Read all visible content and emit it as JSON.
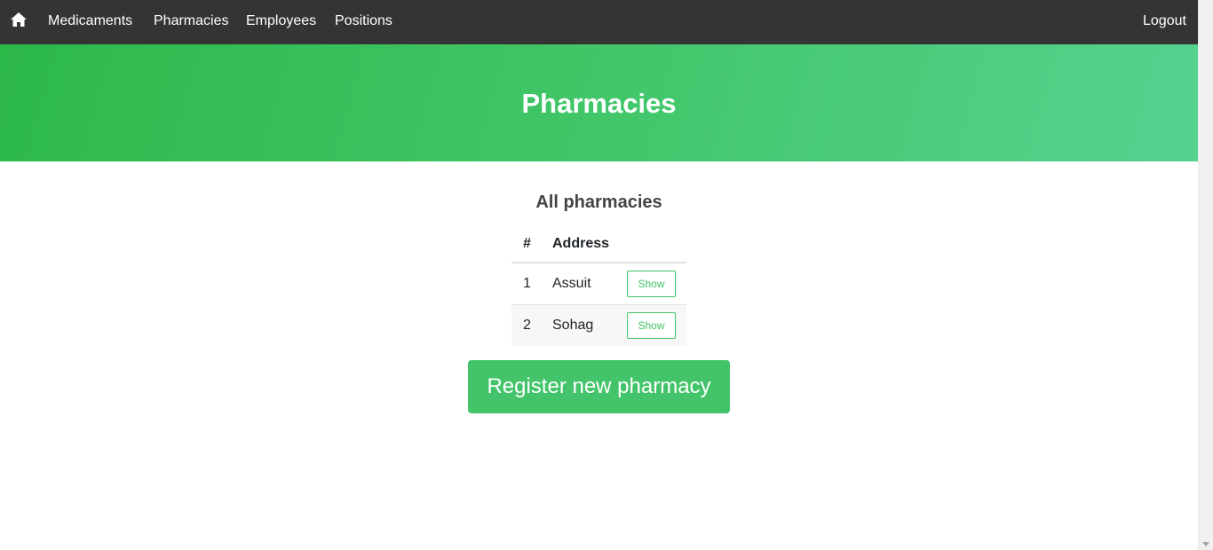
{
  "navbar": {
    "home_icon": "home-icon",
    "items": [
      {
        "label": "Medicaments"
      },
      {
        "label": "Pharmacies"
      },
      {
        "label": "Employees"
      },
      {
        "label": "Positions"
      }
    ],
    "logout_label": "Logout"
  },
  "hero": {
    "title": "Pharmacies"
  },
  "main": {
    "section_title": "All pharmacies",
    "table": {
      "columns": [
        "#",
        "Address"
      ],
      "rows": [
        {
          "num": "1",
          "address": "Assuit",
          "action": "Show"
        },
        {
          "num": "2",
          "address": "Sohag",
          "action": "Show"
        }
      ]
    },
    "register_label": "Register new pharmacy"
  },
  "colors": {
    "navbar_bg": "#343434",
    "accent_green": "#43c46a"
  }
}
